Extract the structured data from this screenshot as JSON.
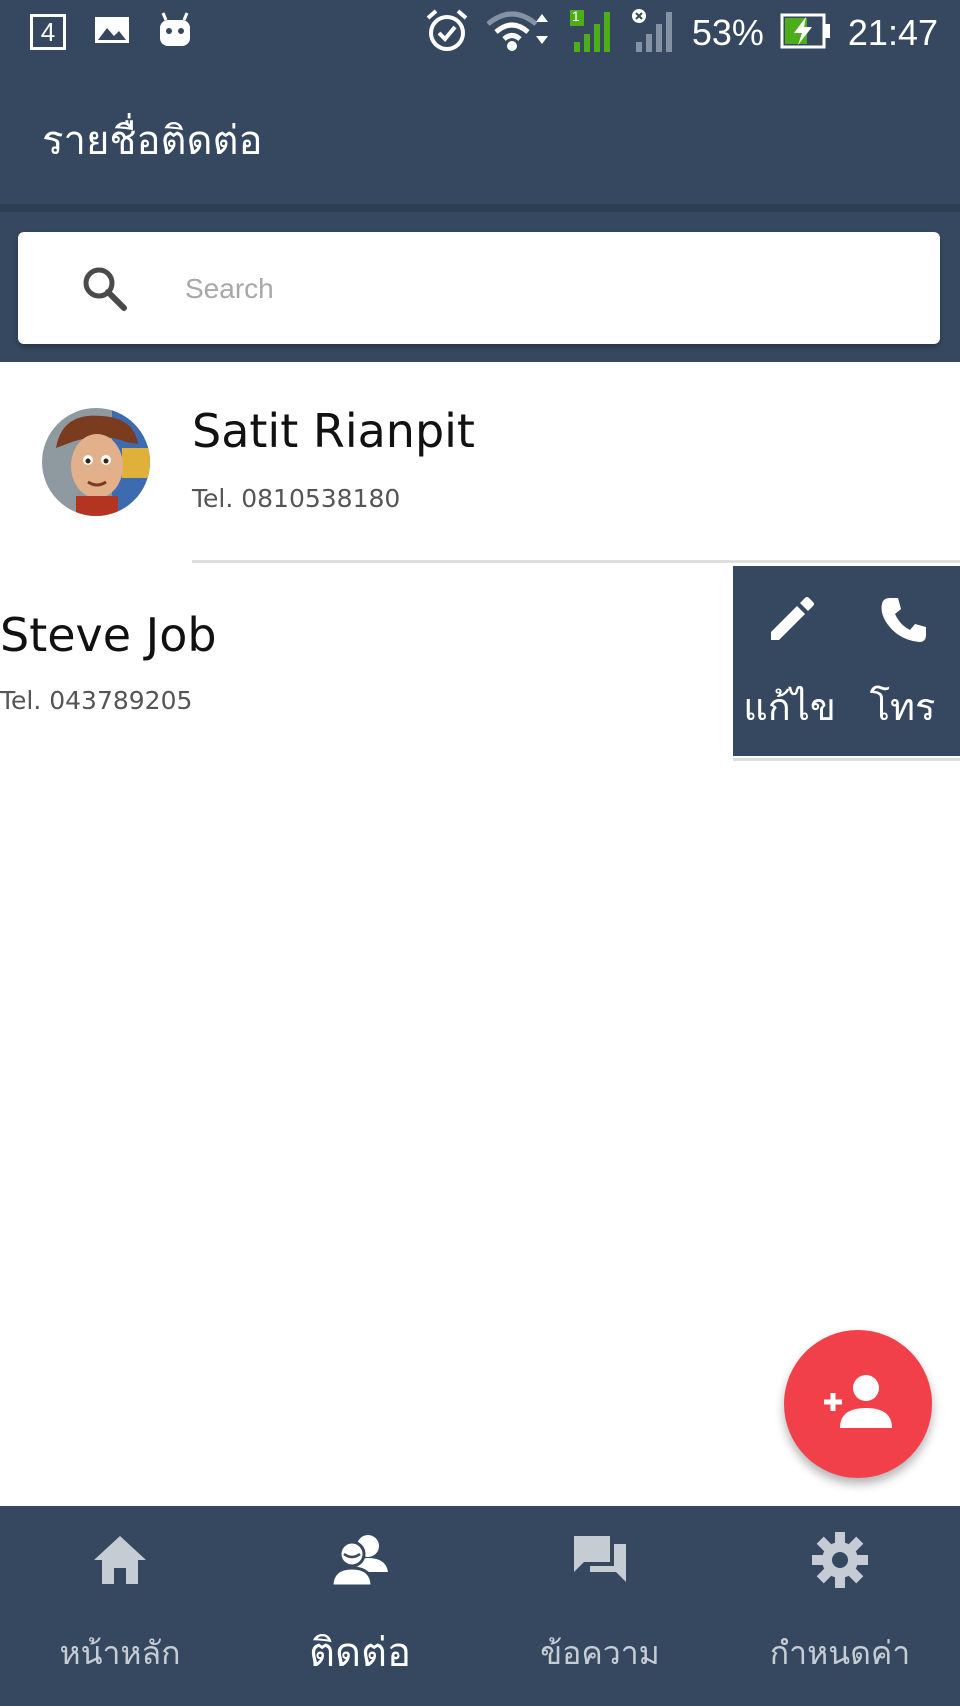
{
  "status_bar": {
    "notification_badge": "4",
    "battery": "53%",
    "time": "21:47",
    "sim_indicator": "1"
  },
  "app_bar": {
    "title": "รายชื่อติดต่อ"
  },
  "search": {
    "placeholder": "Search",
    "value": ""
  },
  "contacts": [
    {
      "name": "Satit  Rianpit",
      "tel": "Tel.  0810538180"
    },
    {
      "name": "Steve  Job",
      "tel": "Tel.  043789205"
    }
  ],
  "swipe_actions": {
    "edit_label": "แก้ไข",
    "call_label": "โทร"
  },
  "bottom_nav": {
    "items": [
      {
        "label": "หน้าหลัก",
        "icon": "home-icon"
      },
      {
        "label": "ติดต่อ",
        "icon": "contacts-icon"
      },
      {
        "label": "ข้อความ",
        "icon": "chat-icon"
      },
      {
        "label": "กำหนดค่า",
        "icon": "gear-icon"
      }
    ]
  },
  "colors": {
    "primary": "#364860",
    "accent": "#f2404a",
    "divider": "#dedede"
  }
}
